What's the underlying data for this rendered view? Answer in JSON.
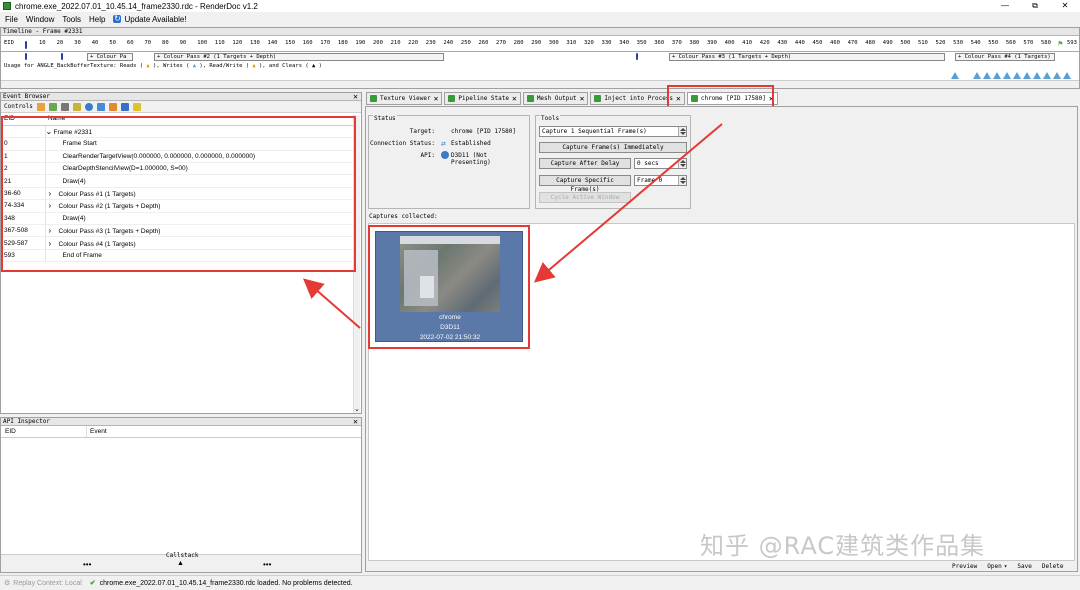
{
  "window": {
    "title": "chrome.exe_2022.07.01_10.45.14_frame2330.rdc - RenderDoc v1.2",
    "controls": [
      "—",
      "⧉",
      "✕"
    ]
  },
  "menu": {
    "file": "File",
    "window": "Window",
    "tools": "Tools",
    "help": "Help",
    "update": "Update Available!"
  },
  "timeline": {
    "title": "Timeline - Frame #2331",
    "eid_label": "EID",
    "ticks": [
      "10",
      "20",
      "30",
      "40",
      "50",
      "60",
      "70",
      "80",
      "90",
      "100",
      "110",
      "120",
      "130",
      "140",
      "150",
      "160",
      "170",
      "180",
      "190",
      "200",
      "210",
      "220",
      "230",
      "240",
      "250",
      "260",
      "270",
      "280",
      "290",
      "300",
      "310",
      "320",
      "330",
      "340",
      "350",
      "360",
      "370",
      "380",
      "390",
      "400",
      "410",
      "420",
      "430",
      "440",
      "450",
      "460",
      "470",
      "480",
      "490",
      "500",
      "510",
      "520",
      "530",
      "540",
      "550",
      "560",
      "570",
      "580"
    ],
    "end_tick": "593",
    "passes": [
      "+ Colour Pa",
      "+ Colour Pass #2 (1 Targets + Depth)",
      "+ Colour Pass #3 (1 Targets + Depth)",
      "+ Colour Pass #4 (1 Targets)"
    ],
    "usage_prefix": "Usage for ANGLE_BackBufferTexture: Reads (",
    "usage_writes": "), Writes (",
    "usage_rw": "), Read/Write (",
    "usage_clears": "), and Clears (",
    "usage_end": ")"
  },
  "event_browser": {
    "title": "Event Browser",
    "controls_label": "Controls",
    "columns": {
      "eid": "EID",
      "name": "Name"
    },
    "rows": [
      {
        "eid": "",
        "name": "Frame #2331",
        "arrow": "⌄"
      },
      {
        "eid": "0",
        "name": "Frame Start",
        "arrow": ""
      },
      {
        "eid": "1",
        "name": "ClearRenderTargetView(0.000000, 0.000000, 0.000000, 0.000000)",
        "arrow": ""
      },
      {
        "eid": "2",
        "name": "ClearDepthStencilView(D=1.000000, S=00)",
        "arrow": ""
      },
      {
        "eid": "21",
        "name": "Draw(4)",
        "arrow": ""
      },
      {
        "eid": "36-60",
        "name": "Colour Pass #1 (1 Targets)",
        "arrow": "›"
      },
      {
        "eid": "74-334",
        "name": "Colour Pass #2 (1 Targets + Depth)",
        "arrow": "›"
      },
      {
        "eid": "348",
        "name": "Draw(4)",
        "arrow": ""
      },
      {
        "eid": "367-508",
        "name": "Colour Pass #3 (1 Targets + Depth)",
        "arrow": "›"
      },
      {
        "eid": "529-587",
        "name": "Colour Pass #4 (1 Targets)",
        "arrow": "›"
      },
      {
        "eid": "593",
        "name": "End of Frame",
        "arrow": ""
      }
    ]
  },
  "api_inspector": {
    "title": "API Inspector",
    "columns": {
      "eid": "EID",
      "event": "Event"
    },
    "callstack": "Callstack",
    "dots": "•••"
  },
  "tabs": [
    {
      "label": "Texture Viewer"
    },
    {
      "label": "Pipeline State"
    },
    {
      "label": "Mesh Output"
    },
    {
      "label": "Inject into Process"
    },
    {
      "label": "chrome [PID 17580]"
    }
  ],
  "status_group": {
    "title": "Status",
    "target_label": "Target:",
    "target_value": "chrome [PID 17580]",
    "connection_label": "Connection Status:",
    "connection_value": "Established",
    "api_label": "API:",
    "api_value": "D3D11 (Not Presenting)"
  },
  "tools_group": {
    "title": "Tools",
    "frames_field": "Capture 1 Sequential Frame(s)",
    "capture_now": "Capture Frame(s) Immediately",
    "capture_delay": "Capture After Delay",
    "delay_value": "0 secs",
    "capture_specific": "Capture Specific Frame(s)",
    "frame_value": "Frame 0",
    "cycle_window": "Cycle Active Window"
  },
  "captures": {
    "label": "Captures collected:",
    "item": {
      "name": "chrome",
      "api": "D3D11",
      "timestamp": "2022-07-02 21:50:32"
    }
  },
  "bottom_actions": {
    "preview": "Preview",
    "open": "Open",
    "save": "Save",
    "delete": "Delete"
  },
  "statusbar": {
    "replay": "Replay Context: Local",
    "message": "chrome.exe_2022.07.01_10.45.14_frame2330.rdc loaded. No problems detected."
  },
  "watermark": "知乎 @RAC建筑类作品集",
  "colors": {
    "annotation": "#e53935",
    "usage_read": "#5a9fd4",
    "accent": "#3a9a3a"
  }
}
